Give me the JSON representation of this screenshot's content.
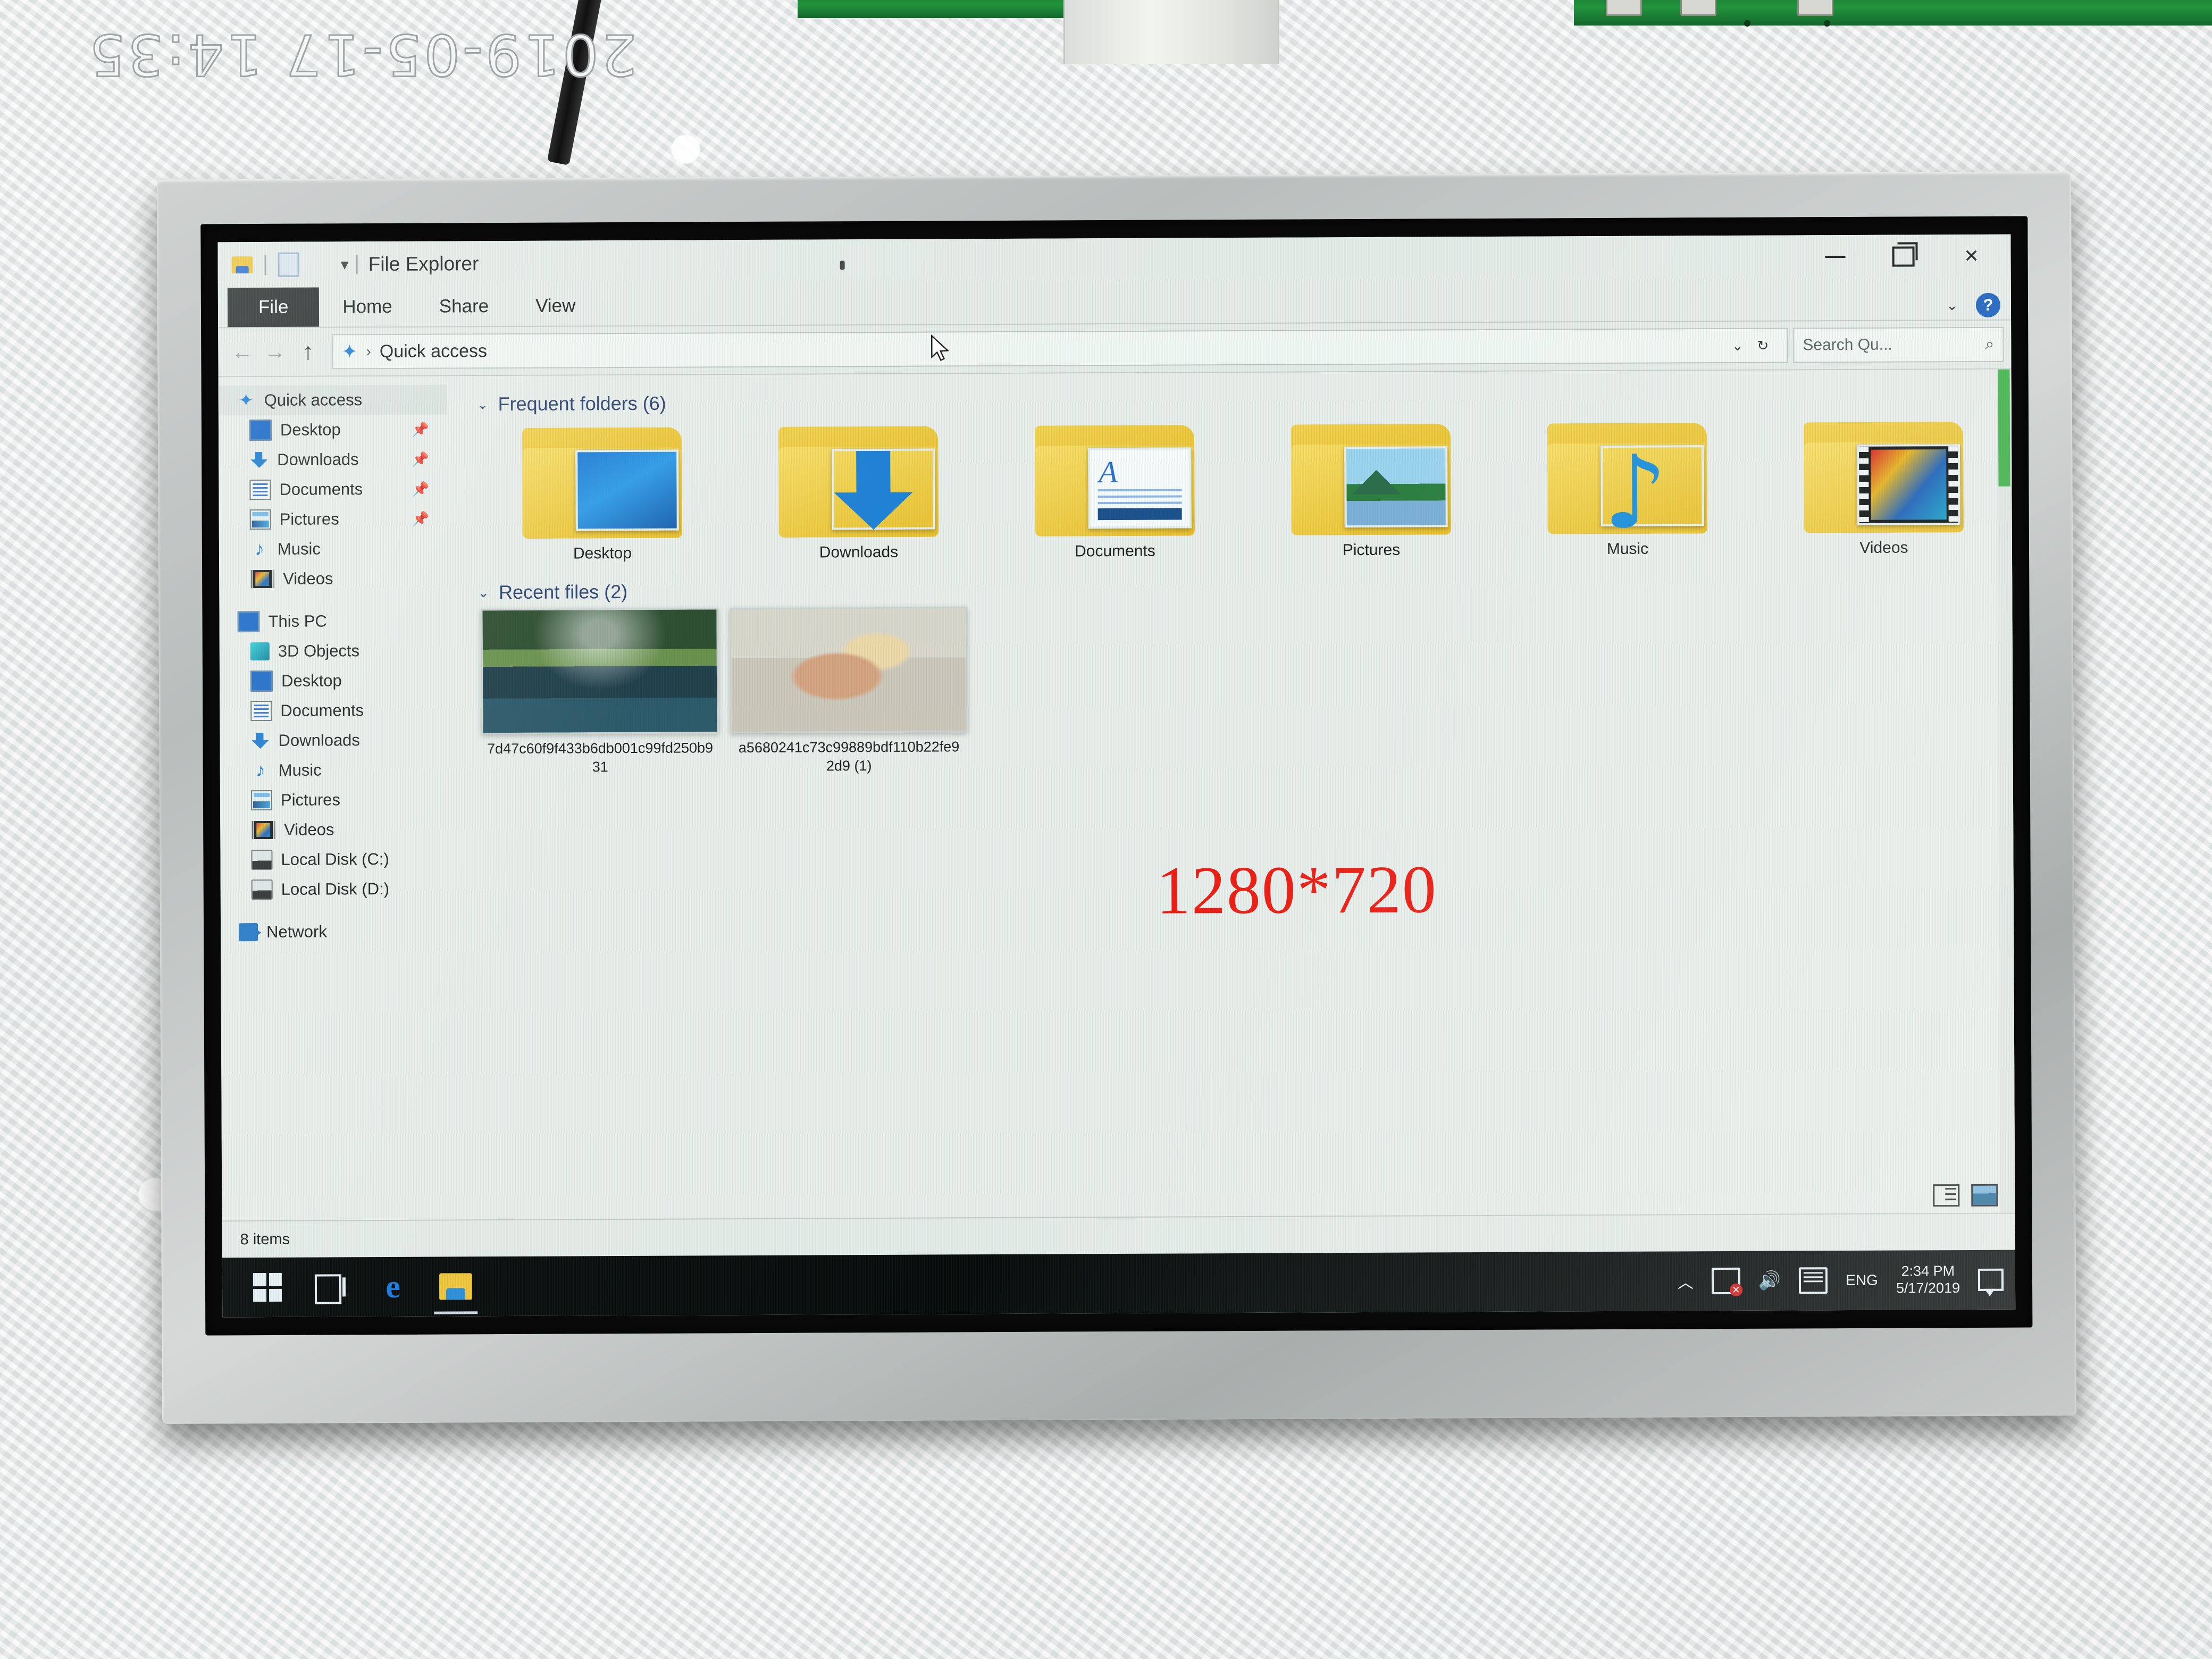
{
  "photo": {
    "camera_timestamp": "2019-05-17 14:35"
  },
  "overlay": {
    "resolution_text": "1280*720",
    "resolution_color": "#f01b12"
  },
  "window": {
    "title": "File Explorer",
    "quick_access_toolbar": [
      {
        "name": "explorer-icon",
        "label": ""
      },
      {
        "name": "properties-icon",
        "label": ""
      },
      {
        "name": "customize-qat-chevron",
        "label": "▾"
      }
    ],
    "controls": {
      "minimize": "—",
      "restore": "❐",
      "close": "✕",
      "ribbon_chevron": "⌄",
      "help": "?"
    }
  },
  "ribbon": {
    "tabs": [
      {
        "label": "File",
        "active": true
      },
      {
        "label": "Home",
        "active": false
      },
      {
        "label": "Share",
        "active": false
      },
      {
        "label": "View",
        "active": false
      }
    ]
  },
  "addressbar": {
    "back": "←",
    "forward": "→",
    "up": "↑",
    "breadcrumb_icon": "star-icon",
    "breadcrumb": "Quick access",
    "separator": "›",
    "history_chevron": "⌄",
    "refresh": "↻",
    "search_placeholder": "Search Qu...",
    "search_icon": "🔍"
  },
  "sidebar": {
    "quick_access": {
      "label": "Quick access",
      "icon": "star-icon",
      "selected": true,
      "items": [
        {
          "label": "Desktop",
          "icon": "desktop-icon",
          "pinned": true
        },
        {
          "label": "Downloads",
          "icon": "downloads-icon",
          "pinned": true
        },
        {
          "label": "Documents",
          "icon": "documents-icon",
          "pinned": true
        },
        {
          "label": "Pictures",
          "icon": "pictures-icon",
          "pinned": true
        },
        {
          "label": "Music",
          "icon": "music-icon",
          "pinned": false
        },
        {
          "label": "Videos",
          "icon": "videos-icon",
          "pinned": false
        }
      ]
    },
    "this_pc": {
      "label": "This PC",
      "icon": "computer-icon",
      "items": [
        {
          "label": "3D Objects",
          "icon": "3d-objects-icon"
        },
        {
          "label": "Desktop",
          "icon": "desktop-icon"
        },
        {
          "label": "Documents",
          "icon": "documents-icon"
        },
        {
          "label": "Downloads",
          "icon": "downloads-icon"
        },
        {
          "label": "Music",
          "icon": "music-icon"
        },
        {
          "label": "Pictures",
          "icon": "pictures-icon"
        },
        {
          "label": "Videos",
          "icon": "videos-icon"
        },
        {
          "label": "Local Disk (C:)",
          "icon": "disk-icon"
        },
        {
          "label": "Local Disk (D:)",
          "icon": "disk-icon"
        }
      ]
    },
    "network": {
      "label": "Network",
      "icon": "network-icon"
    }
  },
  "content": {
    "frequent_folders": {
      "header": "Frequent folders (6)",
      "chevron": "⌄",
      "items": [
        {
          "label": "Desktop",
          "thumb": "desktop-thumb"
        },
        {
          "label": "Downloads",
          "thumb": "download-arrow-thumb"
        },
        {
          "label": "Documents",
          "thumb": "document-thumb"
        },
        {
          "label": "Pictures",
          "thumb": "picture-thumb"
        },
        {
          "label": "Music",
          "thumb": "music-note-thumb"
        },
        {
          "label": "Videos",
          "thumb": "film-strip-thumb"
        }
      ]
    },
    "recent_files": {
      "header": "Recent files (2)",
      "chevron": "⌄",
      "items": [
        {
          "label": "7d47c60f9f433b6db001c99fd250b931",
          "thumb": "landscape-reflection-photo"
        },
        {
          "label": "a5680241c73c99889bdf110b22fe92d9 (1)",
          "thumb": "person-photo"
        }
      ]
    }
  },
  "statusbar": {
    "item_count": "8 items",
    "view_details_icon": "details-view-icon",
    "view_tiles_icon": "large-icons-view-icon"
  },
  "taskbar": {
    "start": "start-button",
    "task_view": "task-view-button",
    "edge": "e",
    "explorer": "file-explorer-button",
    "tray": {
      "caret": "︿",
      "network_icon": "network-disconnected-icon",
      "volume_icon": "🔊",
      "keyboard_icon": "touch-keyboard-icon",
      "language": "ENG",
      "time": "2:34 PM",
      "date": "5/17/2019",
      "action_center_icon": "notifications-icon"
    }
  }
}
